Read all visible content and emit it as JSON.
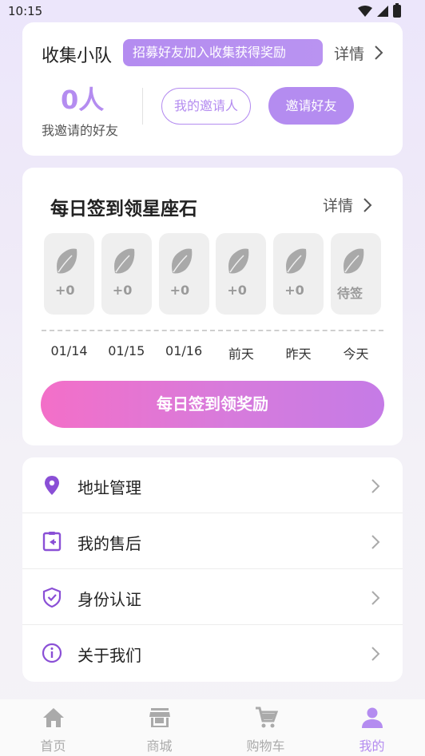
{
  "status_bar": {
    "time": "10:15"
  },
  "team": {
    "title": "收集小队",
    "banner": "招募好友加入收集获得奖励",
    "detail": "详情",
    "count": "0人",
    "count_label": "我邀请的好友",
    "my_inviter": "我的邀请人",
    "invite_friend": "邀请好友"
  },
  "checkin": {
    "title": "每日签到领星座石",
    "detail": "详情",
    "days": [
      {
        "label": "01/14",
        "value": "+0"
      },
      {
        "label": "01/15",
        "value": "+0"
      },
      {
        "label": "01/16",
        "value": "+0"
      },
      {
        "label": "前天",
        "value": "+0"
      },
      {
        "label": "昨天",
        "value": "+0"
      },
      {
        "label": "今天",
        "value": "待签"
      }
    ],
    "button": "每日签到领奖励"
  },
  "menu": {
    "items": [
      {
        "label": "地址管理",
        "icon": "location-pin-icon"
      },
      {
        "label": "我的售后",
        "icon": "after-sales-icon"
      },
      {
        "label": "身份认证",
        "icon": "shield-check-icon"
      },
      {
        "label": "关于我们",
        "icon": "info-icon"
      }
    ]
  },
  "tabs": [
    {
      "label": "首页",
      "icon": "home-icon"
    },
    {
      "label": "商城",
      "icon": "store-icon"
    },
    {
      "label": "购物车",
      "icon": "cart-icon"
    },
    {
      "label": "我的",
      "icon": "user-icon"
    }
  ],
  "colors": {
    "accent": "#b48cf0",
    "icon": "#8a4fd6",
    "button_gradient_start": "#f36fc8",
    "button_gradient_end": "#c57be6"
  }
}
